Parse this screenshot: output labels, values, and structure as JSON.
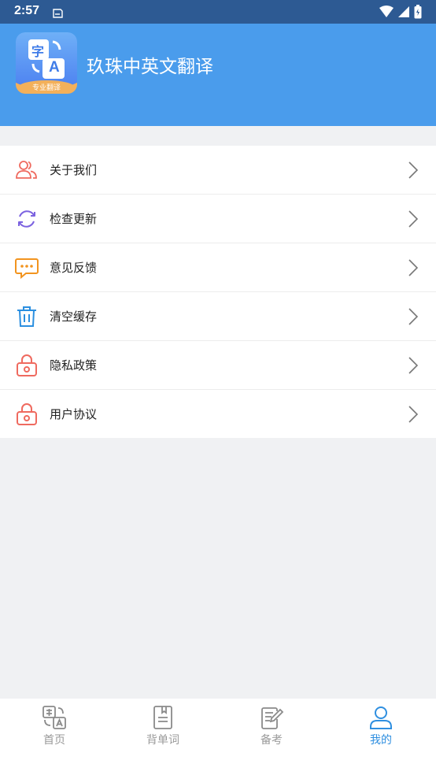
{
  "status_bar": {
    "time": "2:57"
  },
  "header": {
    "app_title": "玖珠中英文翻译",
    "logo_char": "字",
    "logo_letter": "A",
    "logo_badge": "专业翻译"
  },
  "menu": {
    "items": [
      {
        "label": "关于我们",
        "icon": "users-icon",
        "color": "#ef6a5f"
      },
      {
        "label": "检查更新",
        "icon": "refresh-icon",
        "color": "#7c63e0"
      },
      {
        "label": "意见反馈",
        "icon": "feedback-icon",
        "color": "#f2941f"
      },
      {
        "label": "清空缓存",
        "icon": "trash-icon",
        "color": "#2b8fe0"
      },
      {
        "label": "隐私政策",
        "icon": "lock-icon",
        "color": "#ef6a5f"
      },
      {
        "label": "用户协议",
        "icon": "lock-icon",
        "color": "#ef6a5f"
      }
    ]
  },
  "tab_bar": {
    "tabs": [
      {
        "label": "首页",
        "icon": "translate-icon",
        "active": false
      },
      {
        "label": "背单词",
        "icon": "notebook-icon",
        "active": false
      },
      {
        "label": "备考",
        "icon": "edit-document-icon",
        "active": false
      },
      {
        "label": "我的",
        "icon": "user-icon",
        "active": true
      }
    ],
    "active_color": "#2f8fe0",
    "inactive_color": "#9a9a9a"
  },
  "colors": {
    "header_bg": "#4a9cec",
    "status_bg": "#2d5a93",
    "page_bg": "#f0f1f3"
  }
}
